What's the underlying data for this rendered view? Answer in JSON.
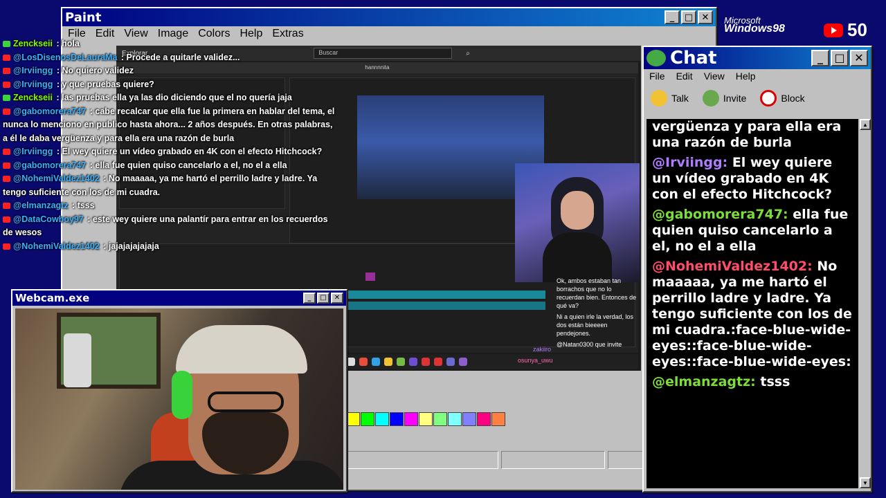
{
  "paint": {
    "title": "Paint",
    "menu": [
      "File",
      "Edit",
      "View",
      "Image",
      "Colors",
      "Help",
      "Extras"
    ],
    "palette": [
      "#ffff00",
      "#00ff00",
      "#00ffff",
      "#0000ff",
      "#ff00ff",
      "#ffff80",
      "#80ff80",
      "#80ffff",
      "#8080ff",
      "#ff0080",
      "#ff8040"
    ]
  },
  "screen": {
    "explorer_label": "Explorar",
    "search_placeholder": "Buscar",
    "project_title": "hannnnita",
    "streamer_chat": [
      "Ok, ambos estaban tan borrachos que no lo recuerdan bien. Entonces de qué va?",
      "Ni a quien irle la verdad, los dos están bieeeen pendejones.",
      "@Natan0300 que invite"
    ],
    "streamer_chat_users": [
      "zakiiro",
      "osunya_uwu"
    ]
  },
  "overlay_chat": [
    {
      "user": "Zenckseii",
      "text": "hola",
      "color": "#7cfc00"
    },
    {
      "user": "@LosDisenosDeLauraMa",
      "text": "Procede a quitarle validez...",
      "color": "#3ab0ff"
    },
    {
      "user": "@Irviingg",
      "text": "No quiero validez",
      "color": "#3ab0ff"
    },
    {
      "user": "@Irviingg",
      "text": "y que pruebas quiere?",
      "color": "#3ab0ff"
    },
    {
      "user": "Zenckseii",
      "text": "las pruebas ella ya las dio diciendo que el no quería jaja",
      "color": "#7cfc00"
    },
    {
      "user": "@gabomorera747",
      "text": "cabe recalcar que ella fue la primera en hablar del tema, el nunca lo menciono en publico hasta ahora... 2 años después. En otras palabras, a él le daba vergüenza y para ella era una razón de burla",
      "color": "#3ab0ff"
    },
    {
      "user": "@Irviingg",
      "text": "El wey quiere un vídeo grabado en 4K con el efecto Hitchcock?",
      "color": "#3ab0ff"
    },
    {
      "user": "@gabomorera747",
      "text": "ella fue quien quiso cancelarlo a el, no el a ella",
      "color": "#3ab0ff"
    },
    {
      "user": "@NohemiValdez1402",
      "text": "No maaaaa, ya me hartó el perrillo ladre y ladre. Ya tengo suficiente con los de mi cuadra.",
      "color": "#3ab0ff"
    },
    {
      "user": "@elmanzagtz",
      "text": "tsss",
      "color": "#3ab0ff"
    },
    {
      "user": "@DataCowboy97",
      "text": "este wey quiere una palantír para entrar en los recuerdos de wesos",
      "color": "#3ab0ff"
    },
    {
      "user": "@NohemiValdez1402",
      "text": "jajajajajajaja",
      "color": "#3ab0ff"
    }
  ],
  "webcam": {
    "title": "Webcam.exe"
  },
  "chat": {
    "title": "Chat",
    "menu": [
      "File",
      "Edit",
      "View",
      "Help"
    ],
    "toolbar": [
      "Talk",
      "Invite",
      "Block"
    ],
    "messages": [
      {
        "user": "",
        "text": "vergüenza y para ella era una razón de burla",
        "color": "#ffffff"
      },
      {
        "user": "@Irviingg:",
        "text": "El wey quiere un vídeo grabado en 4K con el efecto Hitchcock?",
        "color": "#b07cff"
      },
      {
        "user": "@gabomorera747:",
        "text": "ella fue quien quiso cancelarlo a el, no el a ella",
        "color": "#7ddc3a"
      },
      {
        "user": "@NohemiValdez1402:",
        "text": "No maaaaa, ya me hartó el perrillo ladre y ladre. Ya tengo suficiente con los de mi cuadra.:face-blue-wide-eyes::face-blue-wide-eyes::face-blue-wide-eyes:",
        "color": "#ff4d6a"
      },
      {
        "user": "@elmanzagtz:",
        "text": "tsss",
        "color": "#7ddc3a"
      }
    ]
  },
  "branding": {
    "microsoft": "Microsoft",
    "windows": "Windows98",
    "viewer_count": "50"
  }
}
